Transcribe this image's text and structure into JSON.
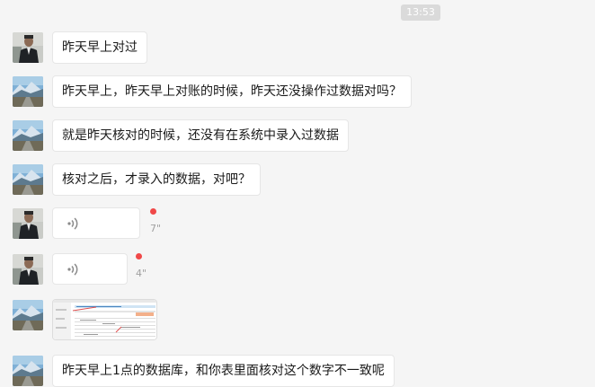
{
  "chat": {
    "timestamp": "13:53",
    "messages": [
      {
        "type": "text",
        "avatar": "man-avatar",
        "text": "昨天早上对过"
      },
      {
        "type": "text",
        "avatar": "mountain-road-avatar",
        "text": "昨天早上，昨天早上对账的时候，昨天还没操作过数据对吗？"
      },
      {
        "type": "text",
        "avatar": "mountain-road-avatar",
        "text": "就是昨天核对的时候，还没有在系统中录入过数据"
      },
      {
        "type": "text",
        "avatar": "mountain-road-avatar",
        "text": "核对之后，才录入的数据，对吧？"
      },
      {
        "type": "voice",
        "avatar": "man-avatar",
        "duration": "7\"",
        "unread": true
      },
      {
        "type": "voice",
        "avatar": "man-avatar",
        "duration": "4\"",
        "unread": true
      },
      {
        "type": "image",
        "avatar": "mountain-road-avatar",
        "description": "spreadsheet-screenshot"
      },
      {
        "type": "text",
        "avatar": "mountain-road-avatar",
        "text": "昨天早上1点的数据库，和你表里面核对这个数字不一致呢"
      }
    ]
  },
  "colors": {
    "background": "#f5f5f5",
    "bubble": "#ffffff",
    "unread_dot": "#f04848",
    "timestamp_bg": "#dadada"
  }
}
